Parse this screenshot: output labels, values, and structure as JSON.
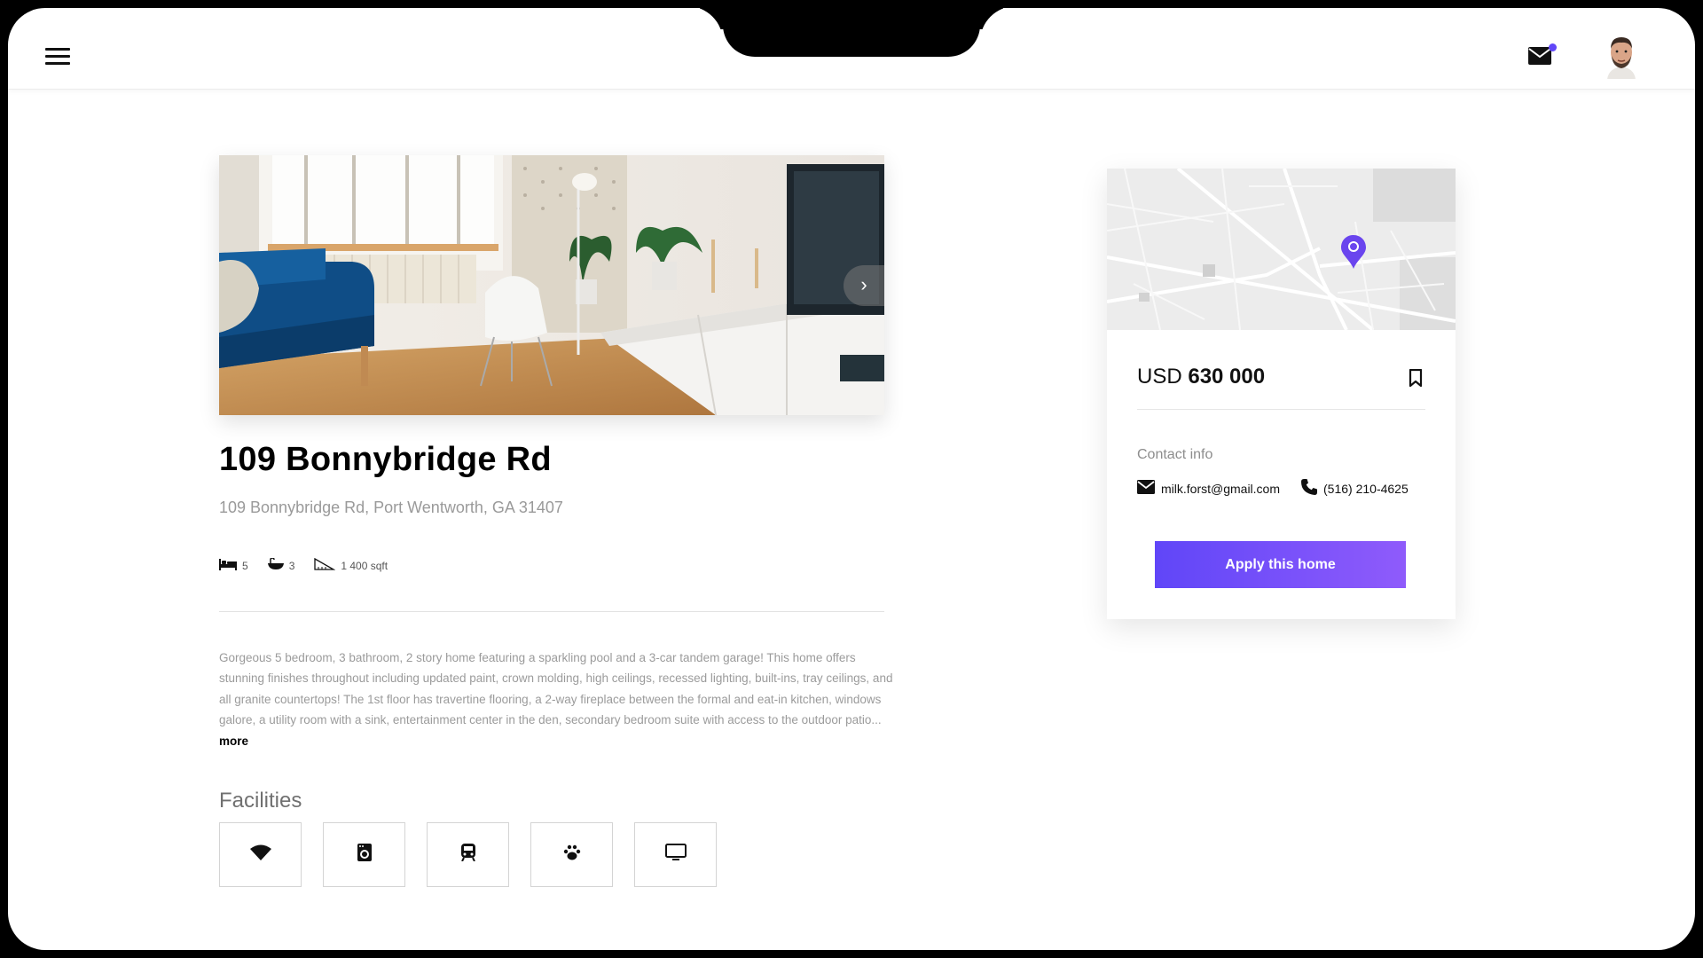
{
  "colors": {
    "accent": "#6046f8",
    "accent_end": "#8f5bfb"
  },
  "header": {
    "menu_icon": "hamburger-menu-icon",
    "mail_icon": "mail-icon",
    "has_notification": true
  },
  "listing": {
    "title": "109 Bonnybridge Rd",
    "address": "109 Bonnybridge Rd, Port Wentworth, GA 31407",
    "features": [
      {
        "icon": "bed-icon",
        "value": "5"
      },
      {
        "icon": "bathtub-icon",
        "value": "3"
      },
      {
        "icon": "area-icon",
        "value": "1 400 sqft"
      }
    ],
    "description": "Gorgeous 5 bedroom, 3 bathroom, 2 story home featuring a sparkling pool and a 3-car tandem garage! This home offers stunning finishes throughout including updated paint, crown molding, high ceilings, recessed lighting, built-ins, tray ceilings, and all granite countertops! The 1st floor has travertine flooring, a 2-way fireplace between the formal and eat-in kitchen, windows galore, a utility room with a sink, entertainment center in the den, secondary bedroom suite with access to the outdoor patio...",
    "more_label": "more",
    "facilities_title": "Facilities",
    "facilities": [
      "wifi-icon",
      "washing-machine-icon",
      "train-icon",
      "paw-icon",
      "tv-icon"
    ]
  },
  "card": {
    "currency": "USD",
    "price": "630 000",
    "contact_label": "Contact info",
    "email": "milk.forst@gmail.com",
    "phone": "(516) 210-4625",
    "apply_label": "Apply this home"
  }
}
